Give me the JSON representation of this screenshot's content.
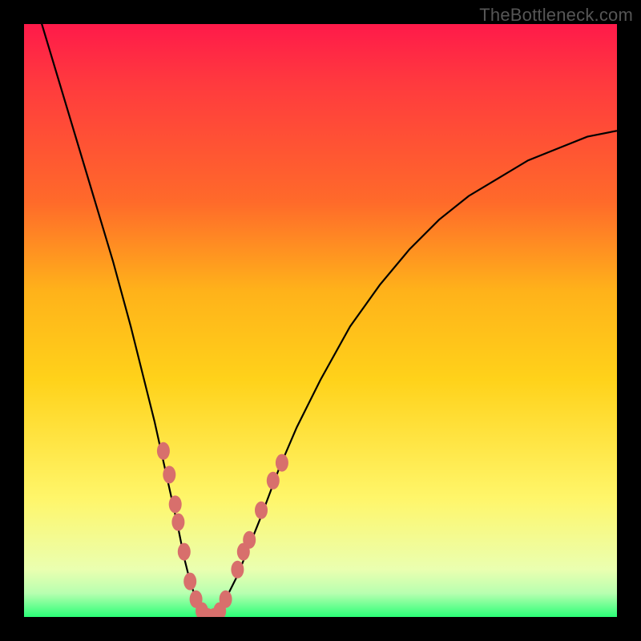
{
  "watermark": "TheBottleneck.com",
  "colors": {
    "frame": "#000000",
    "curve": "#000000",
    "marker_fill": "#d86f6c",
    "marker_stroke": "#b05050",
    "grad_top": "#ff1a4a",
    "grad_mid1": "#ff6a2a",
    "grad_mid2": "#ffd21a",
    "grad_mid3": "#fff66a",
    "grad_mid4": "#eaffb0",
    "grad_bottom": "#2bff77"
  },
  "chart_data": {
    "type": "line",
    "title": "",
    "xlabel": "",
    "ylabel": "",
    "xlim": [
      0,
      100
    ],
    "ylim": [
      0,
      100
    ],
    "curve": {
      "x": [
        0,
        3,
        6,
        9,
        12,
        15,
        18,
        20,
        22,
        24,
        26,
        27,
        28,
        29,
        30,
        31,
        32,
        33,
        34,
        36,
        38,
        40,
        43,
        46,
        50,
        55,
        60,
        65,
        70,
        75,
        80,
        85,
        90,
        95,
        100
      ],
      "y": [
        110,
        100,
        90,
        80,
        70,
        60,
        49,
        41,
        33,
        24,
        15,
        10,
        6,
        3,
        1,
        0,
        0,
        1,
        3,
        7,
        12,
        17,
        25,
        32,
        40,
        49,
        56,
        62,
        67,
        71,
        74,
        77,
        79,
        81,
        82
      ]
    },
    "markers": [
      {
        "x": 23.5,
        "y": 28
      },
      {
        "x": 24.5,
        "y": 24
      },
      {
        "x": 25.5,
        "y": 19
      },
      {
        "x": 26.0,
        "y": 16
      },
      {
        "x": 27.0,
        "y": 11
      },
      {
        "x": 28.0,
        "y": 6
      },
      {
        "x": 29.0,
        "y": 3
      },
      {
        "x": 30.0,
        "y": 1
      },
      {
        "x": 31.0,
        "y": 0
      },
      {
        "x": 32.0,
        "y": 0
      },
      {
        "x": 33.0,
        "y": 1
      },
      {
        "x": 34.0,
        "y": 3
      },
      {
        "x": 36.0,
        "y": 8
      },
      {
        "x": 37.0,
        "y": 11
      },
      {
        "x": 38.0,
        "y": 13
      },
      {
        "x": 40.0,
        "y": 18
      },
      {
        "x": 42.0,
        "y": 23
      },
      {
        "x": 43.5,
        "y": 26
      }
    ]
  }
}
